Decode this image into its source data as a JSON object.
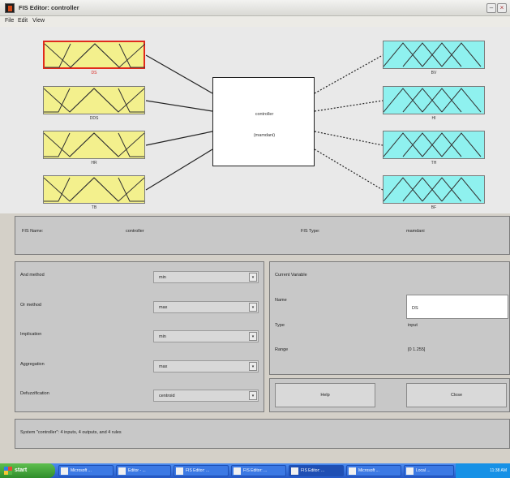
{
  "window": {
    "title": "FIS Editor: controller"
  },
  "menu": [
    "File",
    "Edit",
    "View"
  ],
  "inputs": [
    {
      "label": "DS",
      "selected": true
    },
    {
      "label": "DDS",
      "selected": false
    },
    {
      "label": "HR",
      "selected": false
    },
    {
      "label": "TB",
      "selected": false
    }
  ],
  "outputs": [
    {
      "label": "BV"
    },
    {
      "label": "HI"
    },
    {
      "label": "TH"
    },
    {
      "label": "BF"
    }
  ],
  "system": {
    "name": "controller",
    "type": "(mamdani)"
  },
  "fis_info": {
    "name_label": "FIS Name:",
    "name_value": "controller",
    "type_label": "FIS Type:",
    "type_value": "mamdani"
  },
  "methods": [
    {
      "label": "And method",
      "value": "min"
    },
    {
      "label": "Or method",
      "value": "max"
    },
    {
      "label": "Implication",
      "value": "min"
    },
    {
      "label": "Aggregation",
      "value": "max"
    },
    {
      "label": "Defuzzification",
      "value": "centroid"
    }
  ],
  "current_variable": {
    "title": "Current Variable",
    "name_label": "Name",
    "name_value": "DS",
    "type_label": "Type",
    "type_value": "input",
    "range_label": "Range",
    "range_value": "[0 1.255]"
  },
  "buttons": {
    "help": "Help",
    "close": "Close"
  },
  "status": "System \"controller\": 4 inputs, 4 outputs, and 4 rules",
  "taskbar": {
    "start": "start",
    "tasks": [
      "Microsoft ...",
      "Editor - ...",
      "FIS Editor: ...",
      "FIS Editor: ...",
      "FIS Editor: ...",
      "Microsoft ...",
      "Local ..."
    ],
    "clock": "11:38 AM"
  }
}
